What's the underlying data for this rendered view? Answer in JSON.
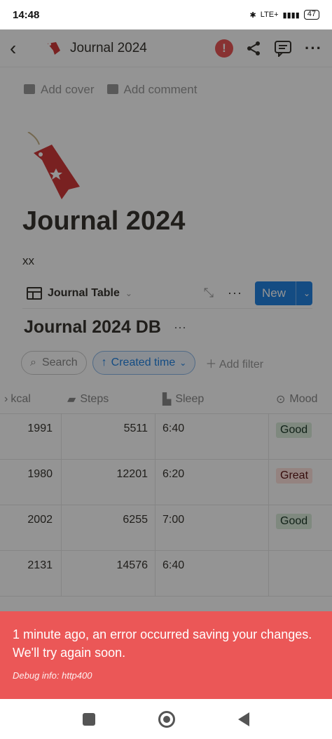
{
  "status": {
    "time": "14:48",
    "battery": "47",
    "network": "LTE+"
  },
  "header": {
    "title": "Journal 2024"
  },
  "page": {
    "add_cover": "Add cover",
    "add_comment": "Add comment",
    "title": "Journal 2024",
    "body_text": "xx"
  },
  "view": {
    "name": "Journal Table",
    "new_label": "New"
  },
  "database": {
    "title": "Journal 2024 DB"
  },
  "filters": {
    "search": "Search",
    "sort": "Created time",
    "add_filter": "Add filter"
  },
  "table": {
    "columns": [
      "kcal",
      "Steps",
      "Sleep",
      "Mood"
    ],
    "rows": [
      {
        "kcal": "1991",
        "steps": "5511",
        "sleep": "6:40",
        "mood": "Good"
      },
      {
        "kcal": "1980",
        "steps": "12201",
        "sleep": "6:20",
        "mood": "Great"
      },
      {
        "kcal": "2002",
        "steps": "6255",
        "sleep": "7:00",
        "mood": "Good"
      },
      {
        "kcal": "2131",
        "steps": "14576",
        "sleep": "6:40",
        "mood": ""
      }
    ]
  },
  "toast": {
    "message": "1 minute ago, an error occurred saving your changes. We'll try again soon.",
    "debug": "Debug info: http400"
  },
  "colors": {
    "error": "#eb5757",
    "accent": "#2383e2"
  }
}
